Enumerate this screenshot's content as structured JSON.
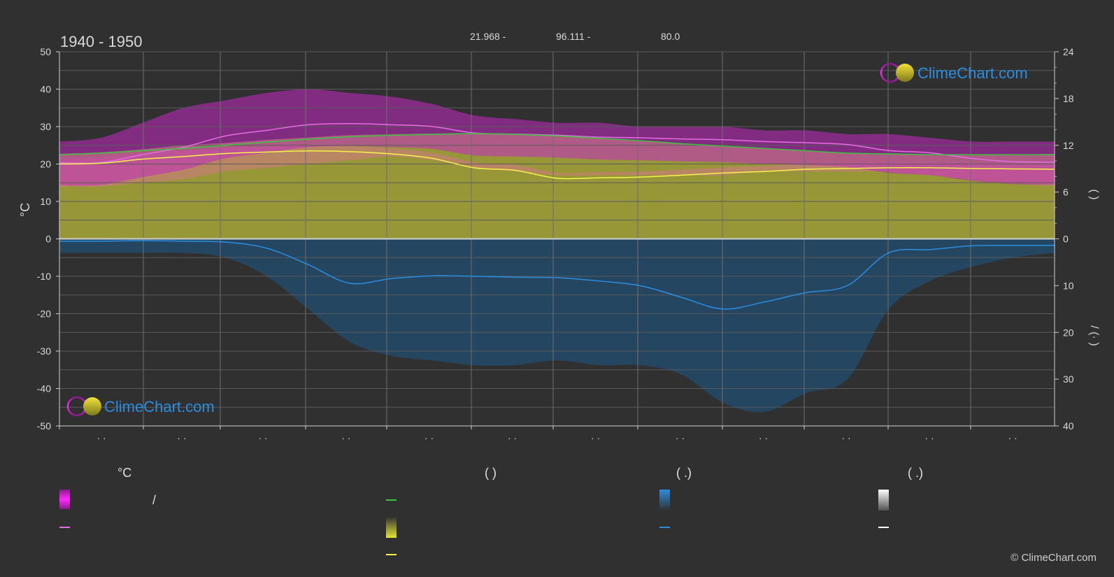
{
  "header": {
    "title": "1940 - 1950",
    "coords": [
      "21.968 -",
      "96.111 -",
      "80.0"
    ]
  },
  "chart_data": {
    "type": "area",
    "title": "1940 - 1950",
    "x_tick_labels": [
      "· ·",
      "· ·",
      "· ·",
      "· ·",
      "· ·",
      "· ·",
      "· ·",
      "· ·",
      "· ·",
      "· ·",
      "· ·",
      "· ·"
    ],
    "left_axis": {
      "label": "°C",
      "range": [
        -50,
        50
      ],
      "ticks": [
        50,
        40,
        30,
        20,
        10,
        0,
        -10,
        -20,
        -30,
        -40,
        -50
      ]
    },
    "right_axis_top": {
      "label": "(      )",
      "range": [
        0,
        24
      ],
      "ticks": [
        24,
        18,
        12,
        6,
        0
      ]
    },
    "right_axis_bottom": {
      "label": "/  (·  )",
      "range": [
        0,
        40
      ],
      "ticks": [
        0,
        10,
        20,
        30,
        40
      ]
    },
    "x": [
      0,
      0.5,
      1,
      1.5,
      2,
      2.5,
      3,
      3.5,
      4,
      4.5,
      5,
      5.5,
      6,
      6.5,
      7,
      7.5,
      8,
      8.5,
      9,
      9.5,
      10,
      10.5,
      11,
      11.5,
      12
    ],
    "series": [
      {
        "name": "",
        "unit": "°C",
        "color": "#e76be7",
        "values": [
          20.3,
          20.4,
          22.5,
          24.5,
          27.5,
          29.0,
          30.5,
          30.8,
          30.5,
          30.0,
          28.3,
          28.0,
          27.7,
          27.2,
          27.0,
          26.7,
          26.5,
          26.0,
          25.7,
          25.2,
          23.6,
          23.0,
          21.5,
          20.6,
          20.5
        ]
      },
      {
        "name": "",
        "unit": "°C",
        "color": "#f4f44a",
        "values": [
          20.0,
          20.2,
          21.3,
          22.0,
          22.8,
          23.2,
          23.5,
          23.3,
          22.7,
          21.5,
          19.0,
          18.3,
          16.2,
          16.3,
          16.5,
          17.0,
          17.6,
          18.0,
          18.6,
          18.8,
          19.0,
          19.0,
          18.8,
          18.7,
          18.6
        ]
      },
      {
        "name": "",
        "unit": "h",
        "color": "#3cc43c",
        "values": [
          10.8,
          11.0,
          11.3,
          11.6,
          12.0,
          12.4,
          12.8,
          13.1,
          13.3,
          13.4,
          13.5,
          13.4,
          13.2,
          12.9,
          12.6,
          12.2,
          11.9,
          11.6,
          11.3,
          11.0,
          10.9,
          10.8,
          10.8,
          10.8,
          10.8
        ]
      },
      {
        "name": "",
        "unit": "mm",
        "color": "#2a8ee0",
        "values": [
          0.5,
          0.5,
          0.4,
          0.5,
          0.7,
          2.0,
          5.5,
          9.5,
          8.5,
          7.9,
          8.0,
          8.2,
          8.3,
          9.0,
          10.0,
          12.5,
          15.0,
          13.5,
          11.5,
          10.0,
          3.0,
          2.3,
          1.5,
          1.4,
          1.4
        ]
      }
    ],
    "band_max_temp_top": [
      26,
      27,
      31,
      35,
      37,
      39,
      40,
      39,
      38,
      36,
      33,
      32,
      31,
      31,
      30,
      30,
      30,
      29,
      29,
      28,
      28,
      27,
      26,
      26,
      26
    ],
    "band_min_temp_bottom": [
      14,
      14,
      15,
      16,
      18,
      19,
      20,
      21,
      22,
      21,
      19,
      18,
      17,
      17,
      17,
      17,
      17,
      18,
      18,
      18,
      18,
      17,
      16,
      15,
      14
    ],
    "band_daylight_top": [
      10.9,
      11.1,
      11.5,
      12.0,
      12.3,
      12.7,
      13.0,
      13.3,
      13.4,
      13.5,
      13.5,
      13.4,
      13.2,
      12.9,
      12.6,
      12.2,
      11.9,
      11.6,
      11.3,
      11.0,
      10.9,
      10.8,
      10.8,
      10.8,
      10.9
    ],
    "band_precip_bottom": [
      3,
      3,
      3,
      3,
      4,
      8,
      15,
      22,
      25,
      26,
      27,
      27,
      26,
      27,
      27,
      29,
      35,
      37,
      33,
      30,
      15,
      9,
      6,
      4,
      3
    ],
    "colors": {
      "background": "#303030",
      "grid": "#5a5a5a",
      "zero_line": "#cfcfcf",
      "max_band": "#c42ac4",
      "min_band": "#e0709a",
      "daylight_band": "#a9a93a",
      "precip_band": "#1d5a8a"
    }
  },
  "logos": {
    "top_right": "ClimeChart.com",
    "bottom_left": "ClimeChart.com"
  },
  "legend": {
    "col1_header": "°C",
    "col1_item1": "/",
    "col2_header": "(          )",
    "col3_header": "(   .)",
    "col4_header": "(   .)",
    "swatch_colors": {
      "temp_range": "#e01ae0",
      "temp_line": "#e76be7",
      "daylight_line": "#3cc43c",
      "sunshine_box": "#d9d935",
      "sunshine_line": "#f4f44a",
      "rain_box": "#2a8ee0",
      "rain_line": "#2a8ee0",
      "snow_box": "#e0e0e0",
      "snow_line": "#ffffff"
    }
  },
  "footer": {
    "copyright": "© ClimeChart.com"
  }
}
